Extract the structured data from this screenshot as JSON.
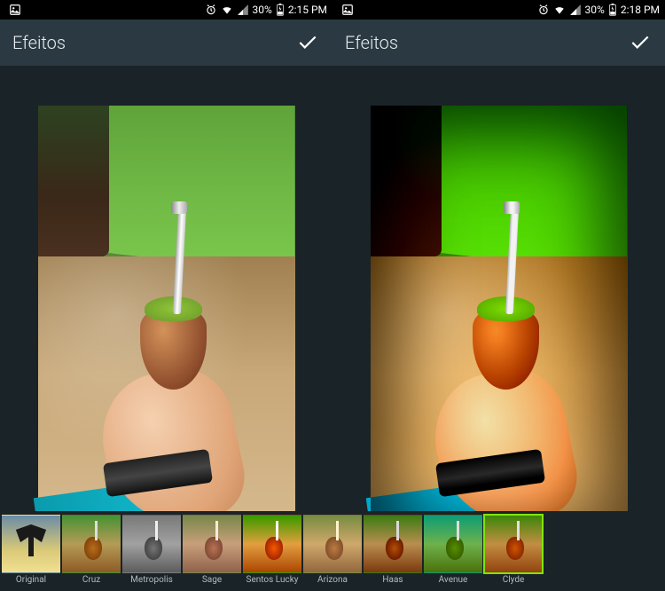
{
  "left": {
    "status": {
      "battery_pct": "30%",
      "time": "2:15 PM"
    },
    "header": {
      "title": "Efeitos"
    }
  },
  "right": {
    "status": {
      "battery_pct": "30%",
      "time": "2:18 PM"
    },
    "header": {
      "title": "Efeitos"
    }
  },
  "filters": [
    {
      "label": "Original"
    },
    {
      "label": "Cruz"
    },
    {
      "label": "Metropolis"
    },
    {
      "label": "Sage"
    },
    {
      "label": "Sentos Lucky"
    },
    {
      "label": "Arizona"
    },
    {
      "label": "Haas"
    },
    {
      "label": "Avenue"
    },
    {
      "label": "Clyde"
    }
  ]
}
